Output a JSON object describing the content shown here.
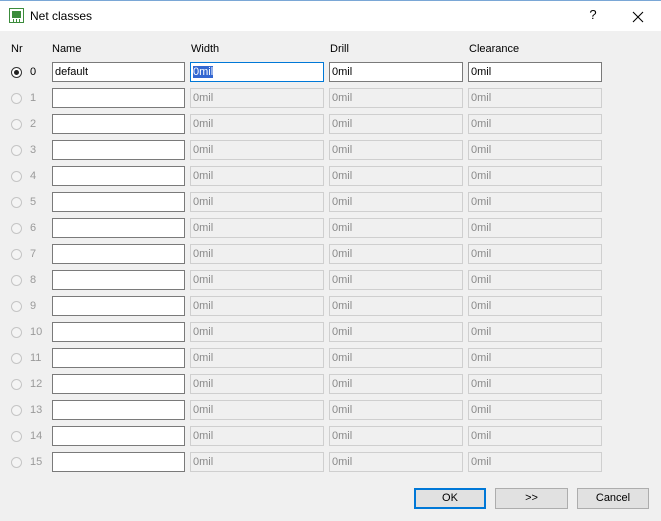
{
  "window": {
    "title": "Net classes",
    "help_label": "?"
  },
  "headers": {
    "nr": "Nr",
    "name": "Name",
    "width": "Width",
    "drill": "Drill",
    "clearance": "Clearance"
  },
  "rows": [
    {
      "nr": "0",
      "name": "default",
      "width": "0mil",
      "drill": "0mil",
      "clearance": "0mil",
      "selected": true,
      "enabled": true
    },
    {
      "nr": "1",
      "name": "",
      "width": "0mil",
      "drill": "0mil",
      "clearance": "0mil",
      "selected": false,
      "enabled": false
    },
    {
      "nr": "2",
      "name": "",
      "width": "0mil",
      "drill": "0mil",
      "clearance": "0mil",
      "selected": false,
      "enabled": false
    },
    {
      "nr": "3",
      "name": "",
      "width": "0mil",
      "drill": "0mil",
      "clearance": "0mil",
      "selected": false,
      "enabled": false
    },
    {
      "nr": "4",
      "name": "",
      "width": "0mil",
      "drill": "0mil",
      "clearance": "0mil",
      "selected": false,
      "enabled": false
    },
    {
      "nr": "5",
      "name": "",
      "width": "0mil",
      "drill": "0mil",
      "clearance": "0mil",
      "selected": false,
      "enabled": false
    },
    {
      "nr": "6",
      "name": "",
      "width": "0mil",
      "drill": "0mil",
      "clearance": "0mil",
      "selected": false,
      "enabled": false
    },
    {
      "nr": "7",
      "name": "",
      "width": "0mil",
      "drill": "0mil",
      "clearance": "0mil",
      "selected": false,
      "enabled": false
    },
    {
      "nr": "8",
      "name": "",
      "width": "0mil",
      "drill": "0mil",
      "clearance": "0mil",
      "selected": false,
      "enabled": false
    },
    {
      "nr": "9",
      "name": "",
      "width": "0mil",
      "drill": "0mil",
      "clearance": "0mil",
      "selected": false,
      "enabled": false
    },
    {
      "nr": "10",
      "name": "",
      "width": "0mil",
      "drill": "0mil",
      "clearance": "0mil",
      "selected": false,
      "enabled": false
    },
    {
      "nr": "11",
      "name": "",
      "width": "0mil",
      "drill": "0mil",
      "clearance": "0mil",
      "selected": false,
      "enabled": false
    },
    {
      "nr": "12",
      "name": "",
      "width": "0mil",
      "drill": "0mil",
      "clearance": "0mil",
      "selected": false,
      "enabled": false
    },
    {
      "nr": "13",
      "name": "",
      "width": "0mil",
      "drill": "0mil",
      "clearance": "0mil",
      "selected": false,
      "enabled": false
    },
    {
      "nr": "14",
      "name": "",
      "width": "0mil",
      "drill": "0mil",
      "clearance": "0mil",
      "selected": false,
      "enabled": false
    },
    {
      "nr": "15",
      "name": "",
      "width": "0mil",
      "drill": "0mil",
      "clearance": "0mil",
      "selected": false,
      "enabled": false
    }
  ],
  "buttons": {
    "ok": "OK",
    "forward": ">>",
    "cancel": "Cancel"
  },
  "colors": {
    "accent": "#0078d7",
    "dialog_bg": "#f0f0f0",
    "icon_green": "#3c8c3c"
  },
  "icons": {
    "app": "board-icon",
    "close": "close-icon"
  }
}
